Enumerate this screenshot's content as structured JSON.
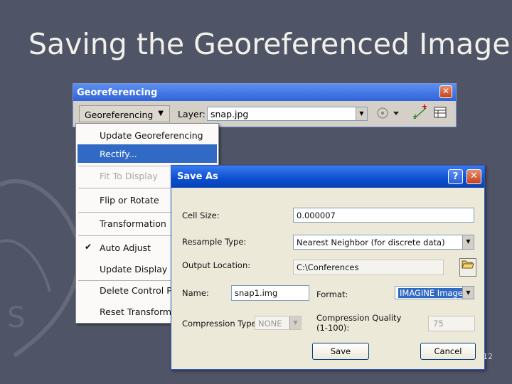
{
  "slide": {
    "title": "Saving the Georeferenced Image",
    "number": "12"
  },
  "geo_window": {
    "title": "Georeferencing",
    "close_glyph": "✕",
    "menu_button": "Georeferencing",
    "menu_arrow": "▼",
    "layer_label": "Layer:",
    "layer_value": "snap.jpg"
  },
  "menu": {
    "items": [
      {
        "label": "Update Georeferencing",
        "state": "normal"
      },
      {
        "label": "Rectify...",
        "state": "selected"
      },
      {
        "label": "Fit To Display",
        "state": "disabled"
      },
      {
        "label": "Flip or Rotate",
        "state": "normal"
      },
      {
        "label": "Transformation",
        "state": "normal"
      },
      {
        "label": "Auto Adjust",
        "state": "checked"
      },
      {
        "label": "Update Display",
        "state": "normal"
      },
      {
        "label": "Delete Control Po",
        "state": "normal"
      },
      {
        "label": "Reset Transforma",
        "state": "normal"
      }
    ],
    "check_glyph": "✔"
  },
  "save_as": {
    "title": "Save As",
    "help_glyph": "?",
    "close_glyph": "✕",
    "cell_size_label": "Cell Size:",
    "cell_size_value": "0.000007",
    "resample_label": "Resample Type:",
    "resample_value": "Nearest Neighbor (for discrete data)",
    "output_label": "Output Location:",
    "output_value": "C:\\Conferences",
    "name_label": "Name:",
    "name_value": "snap1.img",
    "format_label": "Format:",
    "format_value": "IMAGINE Image",
    "compression_label": "Compression Type:",
    "compression_value": "NONE",
    "quality_label_1": "Compression Quality",
    "quality_label_2": "(1-100):",
    "quality_value": "75",
    "save_button": "Save",
    "cancel_button": "Cancel"
  },
  "icons": {
    "combo_arrow": "▼",
    "folder": "folder-open-icon",
    "toolbar_tools": [
      "pan-circle-icon",
      "control-point-icon",
      "link-table-icon"
    ]
  },
  "colors": {
    "slide_bg": "#4f5466",
    "title_text": "#f1f1ea",
    "xp_title_blue": "#0b4ed0",
    "menu_highlight": "#316ac5"
  }
}
